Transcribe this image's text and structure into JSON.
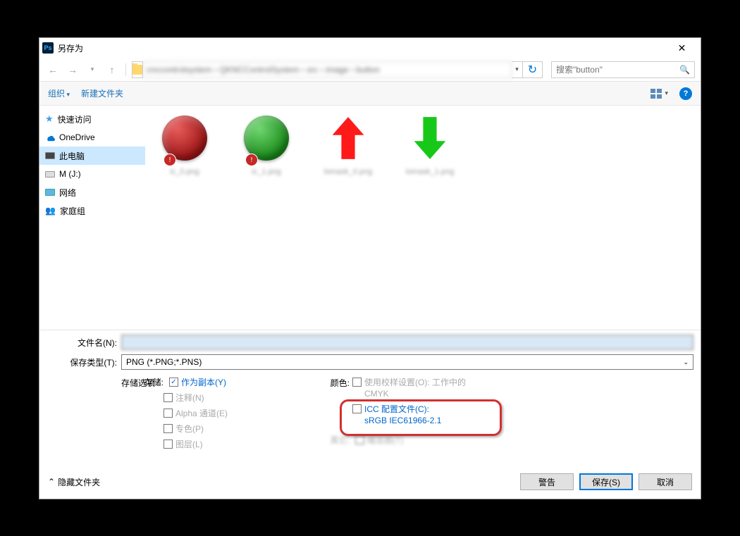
{
  "window": {
    "title": "另存为",
    "ps_logo": "Ps"
  },
  "nav": {
    "path_blur": "cnccontrolsystem › QKNCControlSystem › src › image › button"
  },
  "search": {
    "placeholder": "搜索\"button\""
  },
  "toolbar": {
    "organize": "组织",
    "new_folder": "新建文件夹"
  },
  "sidebar": {
    "items": [
      {
        "label": "快速访问",
        "icon": "star"
      },
      {
        "label": "OneDrive",
        "icon": "onedrive"
      },
      {
        "label": "此电脑",
        "icon": "pc",
        "selected": true
      },
      {
        "label": "M (J:)",
        "icon": "drive"
      },
      {
        "label": "网络",
        "icon": "network"
      },
      {
        "label": "家庭组",
        "icon": "group"
      }
    ]
  },
  "files": [
    {
      "name": "ic_0.png",
      "kind": "red-circle"
    },
    {
      "name": "ic_1.png",
      "kind": "green-circle"
    },
    {
      "name": "lomask_0.png",
      "kind": "red-up-arrow"
    },
    {
      "name": "lomask_1.png",
      "kind": "green-down-arrow"
    }
  ],
  "form": {
    "filename_label": "文件名(N):",
    "filetype_label": "保存类型(T):",
    "filetype_value": "PNG (*.PNG;*.PNS)",
    "save_options_label": "存储选项",
    "save_label": "存储:",
    "color_label": "颜色:",
    "other_label": "其它:",
    "save_opts": {
      "as_copy": "作为副本(Y)",
      "notes": "注释(N)",
      "alpha": "Alpha 通道(E)",
      "spot": "专色(P)",
      "layers": "图层(L)"
    },
    "color_opts": {
      "proof": "使用校样设置(O):  工作中的 CMYK",
      "icc_line1": "ICC 配置文件(C):",
      "icc_line2": "sRGB IEC61966-2.1",
      "thumb": "缩览图(T)"
    }
  },
  "footer": {
    "hide_folders": "隐藏文件夹",
    "warn": "警告",
    "save": "保存(S)",
    "cancel": "取消"
  }
}
